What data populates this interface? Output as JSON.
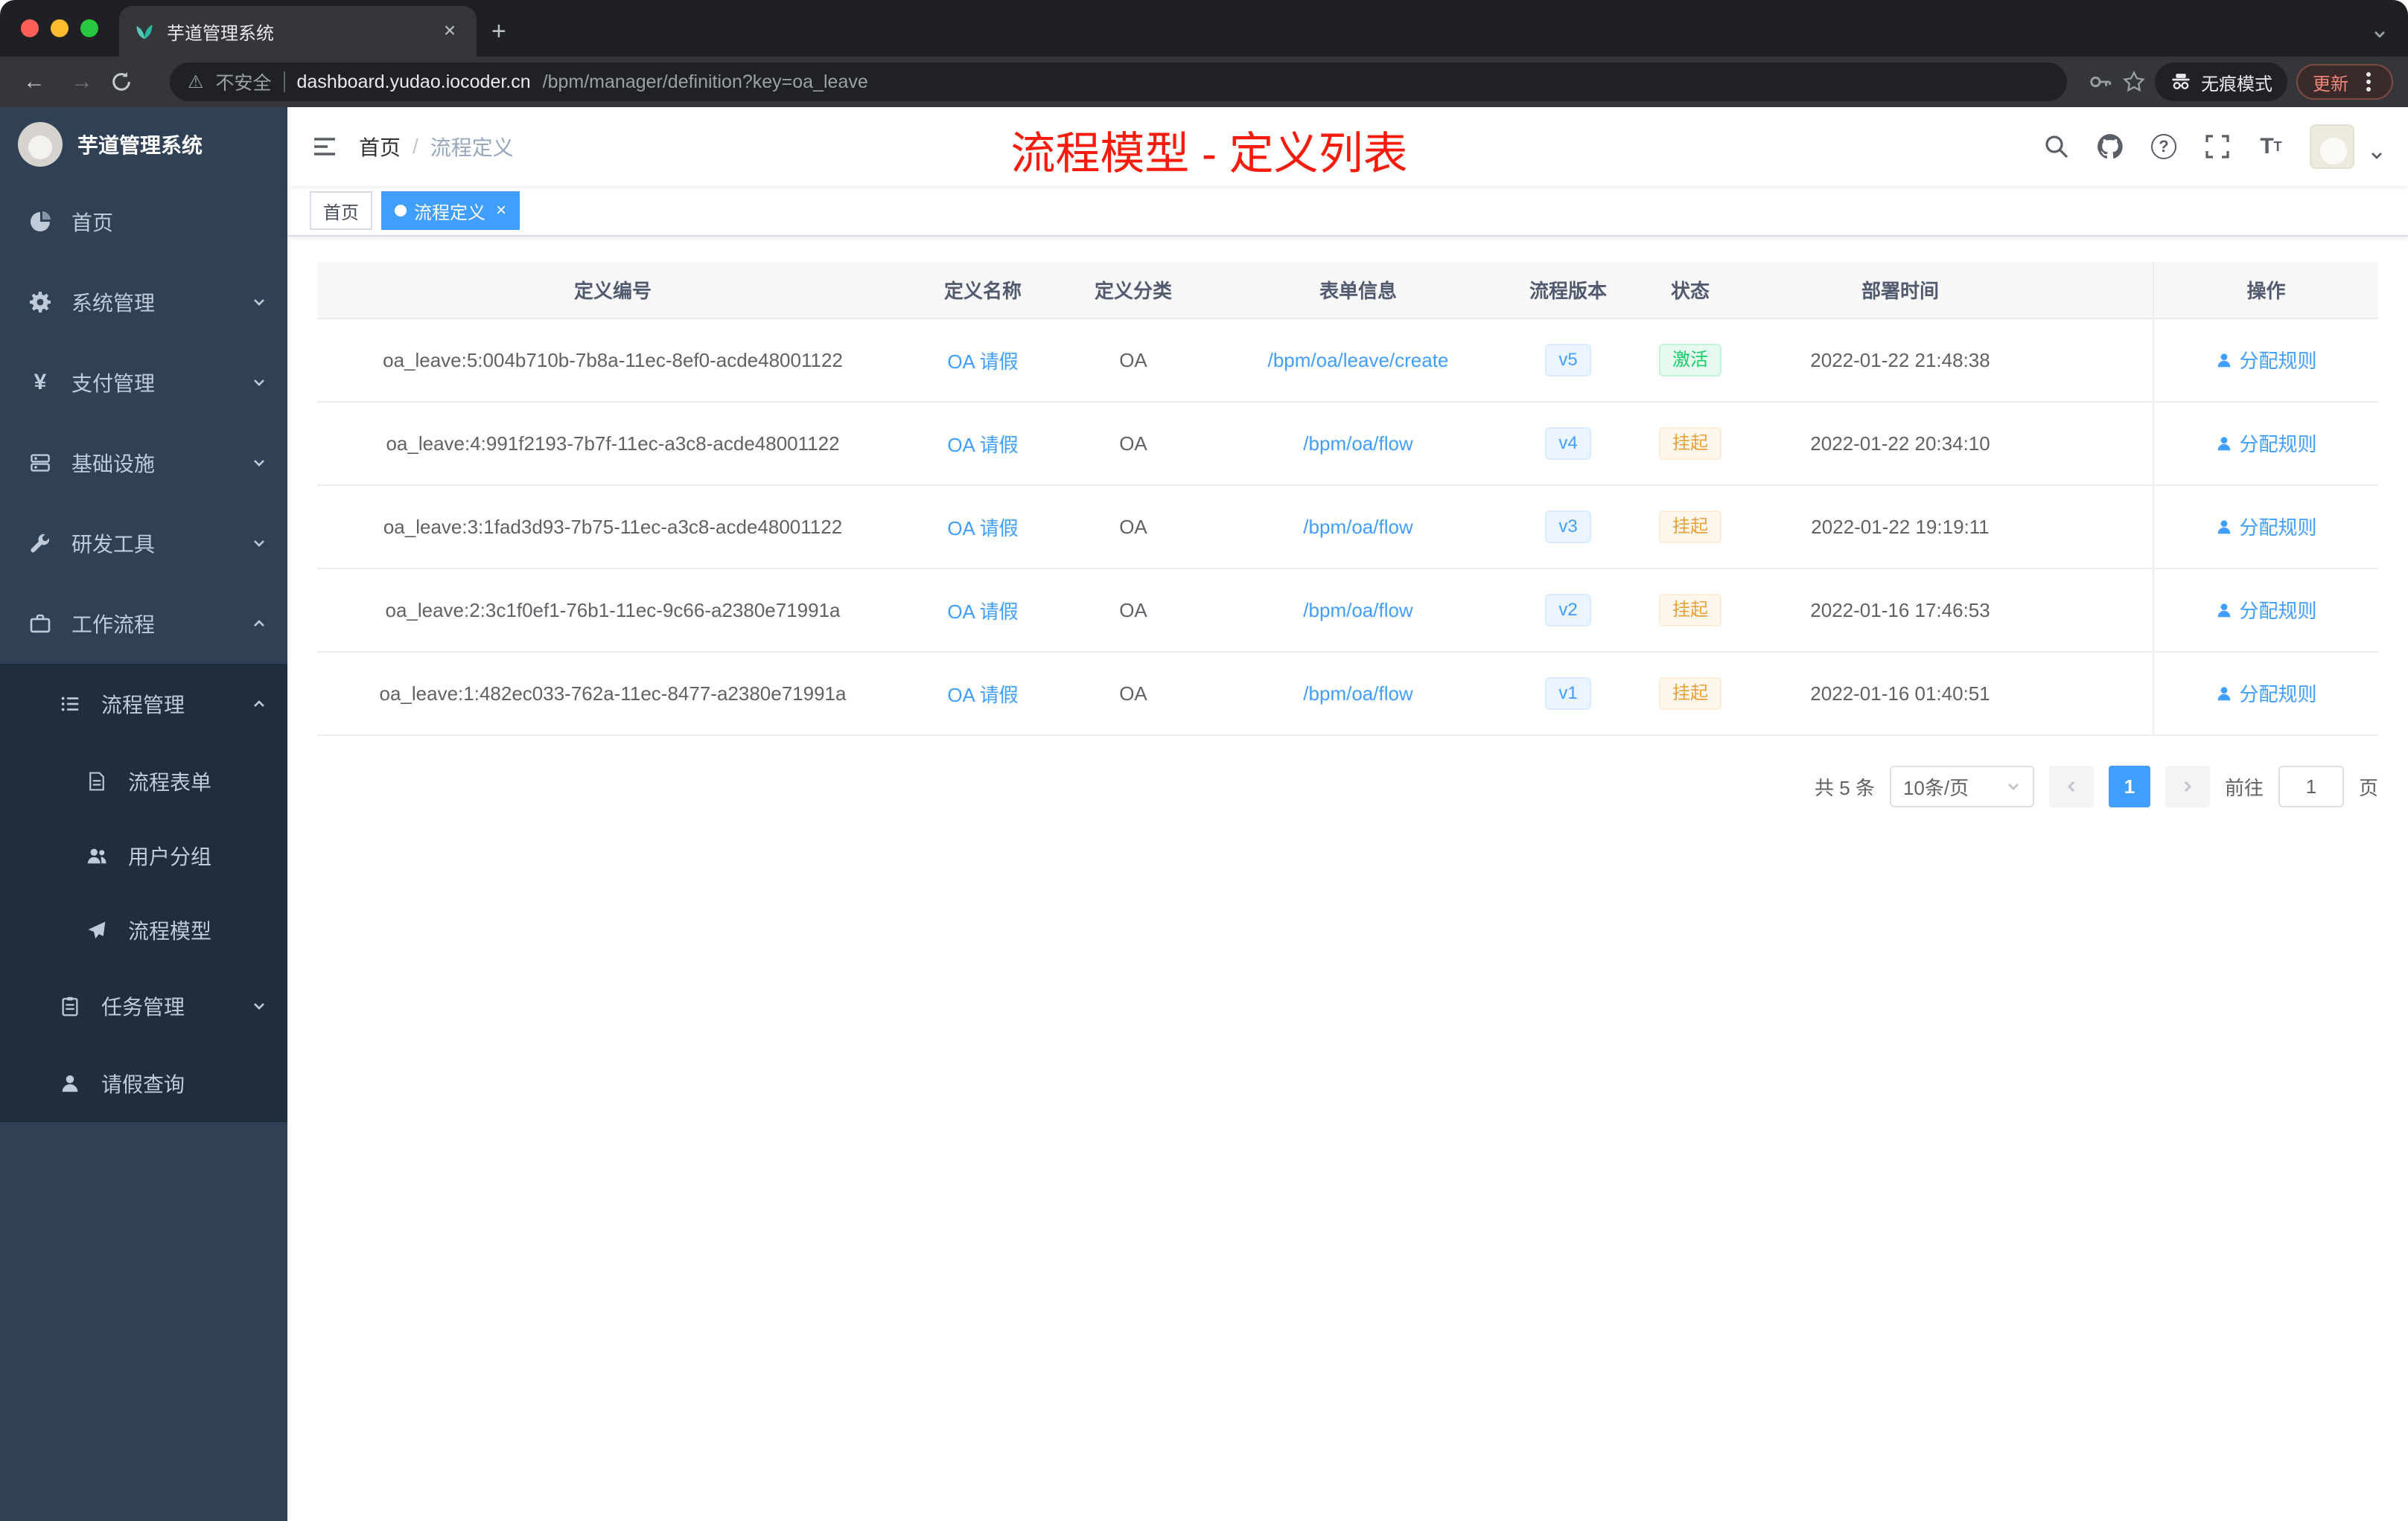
{
  "colors": {
    "accent": "#409eff",
    "annotation": "#f81c0c",
    "success": "#13ce66",
    "warning": "#e6a23c",
    "sidebar_bg": "#304156",
    "submenu_bg": "#1f2d3d"
  },
  "browser": {
    "tab": {
      "title": "芋道管理系统"
    },
    "toolbar": {
      "security_label": "不安全",
      "url_host": "dashboard.yudao.iocoder.cn",
      "url_path": "/bpm/manager/definition?key=oa_leave",
      "incognito_label": "无痕模式",
      "update_label": "更新"
    }
  },
  "sidebar": {
    "app_title": "芋道管理系统",
    "items": [
      {
        "label": "首页"
      },
      {
        "label": "系统管理"
      },
      {
        "label": "支付管理"
      },
      {
        "label": "基础设施"
      },
      {
        "label": "研发工具"
      },
      {
        "label": "工作流程"
      },
      {
        "label": "流程管理"
      },
      {
        "label": "流程表单"
      },
      {
        "label": "用户分组"
      },
      {
        "label": "流程模型"
      },
      {
        "label": "任务管理"
      },
      {
        "label": "请假查询"
      }
    ]
  },
  "navbar": {
    "breadcrumb": {
      "home": "首页",
      "separator": "/",
      "current": "流程定义"
    },
    "annotation": "流程模型 - 定义列表"
  },
  "tags": {
    "items": [
      {
        "label": "首页",
        "active": false
      },
      {
        "label": "流程定义",
        "active": true
      }
    ]
  },
  "table": {
    "columns": [
      "定义编号",
      "定义名称",
      "定义分类",
      "表单信息",
      "流程版本",
      "状态",
      "部署时间",
      "操作"
    ],
    "rows": [
      {
        "id": "oa_leave:5:004b710b-7b8a-11ec-8ef0-acde48001122",
        "name": "OA 请假",
        "category": "OA",
        "form": "/bpm/oa/leave/create",
        "version": "v5",
        "status": "激活",
        "status_type": "success",
        "time": "2022-01-22 21:48:38",
        "action": "分配规则"
      },
      {
        "id": "oa_leave:4:991f2193-7b7f-11ec-a3c8-acde48001122",
        "name": "OA 请假",
        "category": "OA",
        "form": "/bpm/oa/flow",
        "version": "v4",
        "status": "挂起",
        "status_type": "warning",
        "time": "2022-01-22 20:34:10",
        "action": "分配规则"
      },
      {
        "id": "oa_leave:3:1fad3d93-7b75-11ec-a3c8-acde48001122",
        "name": "OA 请假",
        "category": "OA",
        "form": "/bpm/oa/flow",
        "version": "v3",
        "status": "挂起",
        "status_type": "warning",
        "time": "2022-01-22 19:19:11",
        "action": "分配规则"
      },
      {
        "id": "oa_leave:2:3c1f0ef1-76b1-11ec-9c66-a2380e71991a",
        "name": "OA 请假",
        "category": "OA",
        "form": "/bpm/oa/flow",
        "version": "v2",
        "status": "挂起",
        "status_type": "warning",
        "time": "2022-01-16 17:46:53",
        "action": "分配规则"
      },
      {
        "id": "oa_leave:1:482ec033-762a-11ec-8477-a2380e71991a",
        "name": "OA 请假",
        "category": "OA",
        "form": "/bpm/oa/flow",
        "version": "v1",
        "status": "挂起",
        "status_type": "warning",
        "time": "2022-01-16 01:40:51",
        "action": "分配规则"
      }
    ]
  },
  "pagination": {
    "total": "共 5 条",
    "page_size": "10条/页",
    "current_page": "1",
    "goto": "前往",
    "goto_value": "1",
    "unit": "页"
  }
}
